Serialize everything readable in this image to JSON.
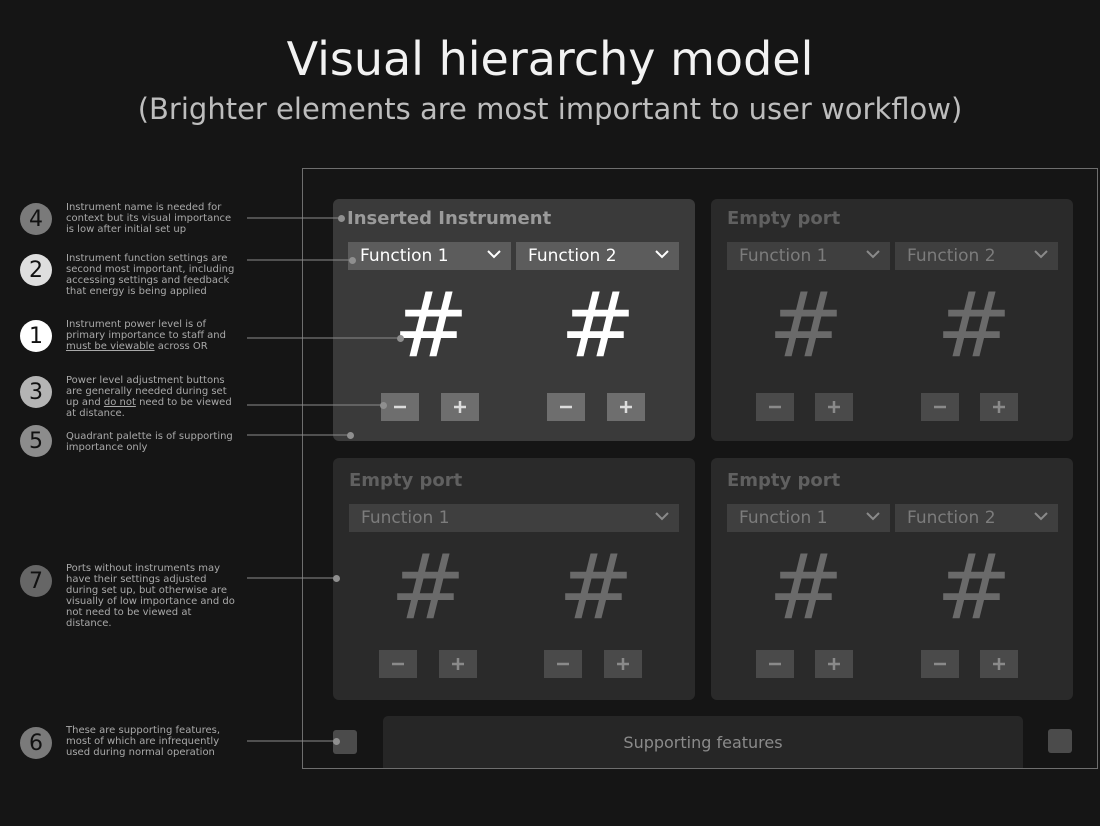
{
  "title": "Visual hierarchy model",
  "subtitle": "(Brighter elements are most important to user workflow)",
  "quadrants": [
    {
      "title": "Inserted Instrument",
      "functions": [
        "Function 1",
        "Function 2"
      ],
      "values": [
        "#",
        "#"
      ],
      "minus": "−",
      "plus": "+"
    },
    {
      "title": "Empty port",
      "functions": [
        "Function 1",
        "Function 2"
      ],
      "values": [
        "#",
        "#"
      ],
      "minus": "−",
      "plus": "+"
    },
    {
      "title": "Empty port",
      "functions": [
        "Function 1"
      ],
      "values": [
        "#",
        "#"
      ],
      "minus": "−",
      "plus": "+"
    },
    {
      "title": "Empty port",
      "functions": [
        "Function 1",
        "Function 2"
      ],
      "values": [
        "#",
        "#"
      ],
      "minus": "−",
      "plus": "+"
    }
  ],
  "supporting_bar_label": "Supporting features",
  "annotations": [
    {
      "number": "4",
      "lines": [
        "Instrument name is needed for",
        "context but its visual importance",
        "is low after initial set up"
      ]
    },
    {
      "number": "2",
      "lines": [
        "Instrument function settings are",
        "second most important, including",
        "accessing settings and feedback",
        "that energy is being applied"
      ]
    },
    {
      "number": "1",
      "pre": "Instrument power level is of",
      "mid": "primary importance to staff and",
      "underlined": "must be viewable",
      "post": " across OR"
    },
    {
      "number": "3",
      "lines": [
        "Power level adjustment buttons",
        "are generally needed during set"
      ],
      "l3pre": "up and ",
      "l3u": "do not",
      "l3post": " need to be viewed",
      "l4": "at distance."
    },
    {
      "number": "5",
      "lines": [
        "Quadrant palette is of supporting",
        "importance only"
      ]
    },
    {
      "number": "7",
      "lines": [
        "Ports without instruments may",
        "have their settings adjusted",
        "during set up, but otherwise are",
        "visually of low importance and do",
        "not need to be viewed at",
        "distance."
      ]
    },
    {
      "number": "6",
      "lines": [
        "These are supporting features,",
        "most of which are infrequently",
        "used during normal operation"
      ]
    }
  ],
  "colors": {
    "background": "#151515",
    "active_quadrant": "#3a3a3a",
    "inactive_quadrant": "#2a2a2a",
    "active_dropdown": "#5c5c5c",
    "inactive_dropdown": "#3f3f3f",
    "bubble_bright": "#ffffff",
    "bubble_dim": "#7a7a7a"
  }
}
